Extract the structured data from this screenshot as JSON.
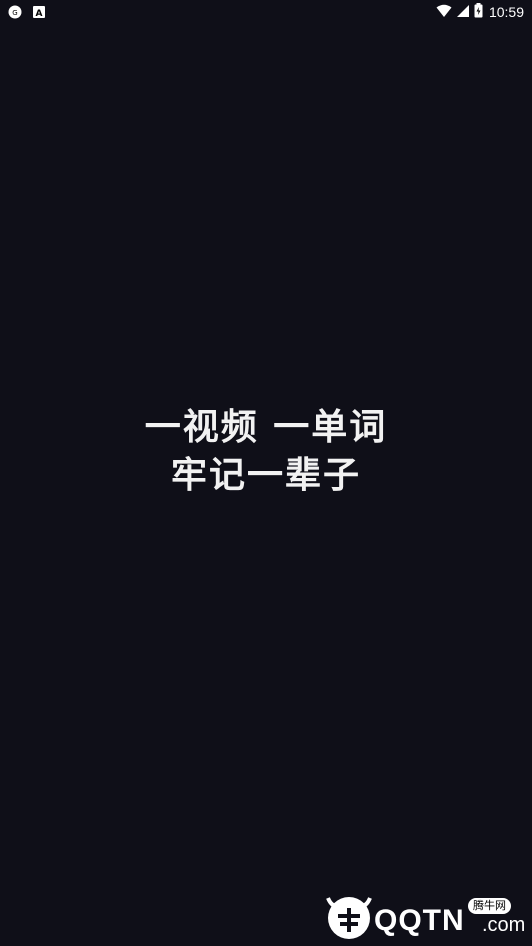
{
  "status_bar": {
    "left_icons": [
      "compass-icon",
      "text-a-icon"
    ],
    "right_icons": [
      "wifi-icon",
      "signal-icon",
      "battery-icon"
    ],
    "time": "10:59"
  },
  "splash": {
    "line1": "一视频 一单词",
    "line2": "牢记一辈子"
  },
  "watermark": {
    "main": "QQTN",
    "suffix": ".com",
    "badge": "腾牛网"
  },
  "colors": {
    "background": "#0f0f18",
    "text": "#f2f2f2"
  }
}
